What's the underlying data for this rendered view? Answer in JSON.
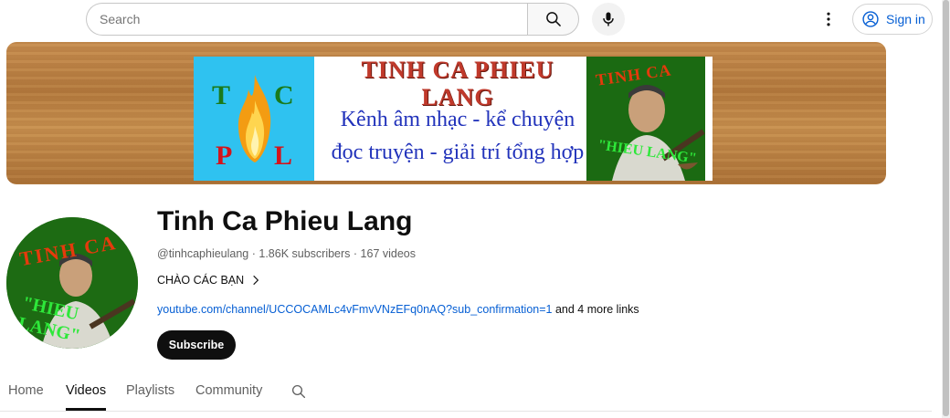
{
  "search": {
    "placeholder": "Search"
  },
  "header": {
    "sign_in_label": "Sign in"
  },
  "banner": {
    "logo_letters": [
      "T",
      "C",
      "P",
      "L"
    ],
    "title": "TINH CA PHIEU LANG",
    "line1": "Kênh âm nhạc - kể chuyện",
    "line2": "đọc truyện - giải trí tổng hợp",
    "photo_text_top": "TINH CA",
    "photo_text_bottom": "\"HIEU LANG\""
  },
  "avatar": {
    "text_top": "TINH CA",
    "text_bottom": "\"HIEU LANG\""
  },
  "channel": {
    "name": "Tinh Ca Phieu Lang",
    "handle": "@tinhcaphieulang",
    "subscribers": "1.86K subscribers",
    "videos": "167 videos",
    "separator": " · ",
    "description": "CHÀO CÁC BẠN",
    "link_url": "youtube.com/channel/UCCOCAMLc4vFmvVNzEFq0nAQ?sub_confirmation=1",
    "more_links": "and 4 more links",
    "subscribe_label": "Subscribe"
  },
  "tabs": [
    {
      "label": "Home"
    },
    {
      "label": "Videos"
    },
    {
      "label": "Playlists"
    },
    {
      "label": "Community"
    }
  ],
  "active_tab": "Videos",
  "colors": {
    "link": "#065fd4",
    "subscribe_bg": "#0f0f0f",
    "logo_bg": "#2fc2f0",
    "photo_bg": "#1b6a12"
  },
  "icons": [
    "search-icon",
    "microphone-icon",
    "more-vert-icon",
    "account-circle-icon",
    "chevron-right-icon",
    "flame-icon"
  ]
}
